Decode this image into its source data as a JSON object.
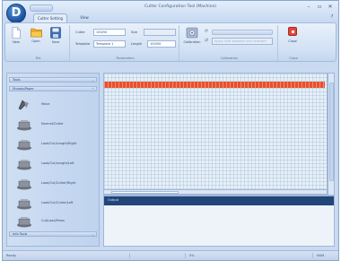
{
  "window": {
    "title": "Cutter Configuration Tool (Machine)",
    "app_button_glyph": "D",
    "controls": [
      "–",
      "▫",
      "✕"
    ],
    "ribbon_help": "?"
  },
  "tabs": [
    {
      "label": "Cutter Setting",
      "active": true
    },
    {
      "label": "View",
      "active": false
    }
  ],
  "ribbon": {
    "file_buttons": [
      {
        "label": "New",
        "icon": "new-document-icon"
      },
      {
        "label": "Open",
        "icon": "open-folder-icon"
      },
      {
        "label": "Save",
        "icon": "save-disk-icon"
      }
    ],
    "file_group_label": "File",
    "params": {
      "cutter_label": "Cutter",
      "cutter_value": "100/50",
      "size_label": "Size",
      "size_value": "",
      "template_label": "Template",
      "template_value": "Template 1",
      "length_label": "Length",
      "length_value": "100/50"
    },
    "params_group_label": "Parameters",
    "calibration": {
      "button_label": "Calibration",
      "row1_text": "",
      "row2_text": "Apply shift between the selected"
    },
    "calibration_group_label": "Calibration",
    "close_button_label": "Close",
    "close_group_label": "Close"
  },
  "left_panel": {
    "sections": [
      {
        "label": "Tools",
        "expanded": false
      },
      {
        "label": "Shapes/Paper",
        "expanded": true
      },
      {
        "label": "Info Tools",
        "expanded": false
      }
    ],
    "items": [
      {
        "label": "Move"
      },
      {
        "label": "Normal/Cutter"
      },
      {
        "label": "Load/Cut/Length/Right"
      },
      {
        "label": "Load/Cut/Length/Left"
      },
      {
        "label": "Load/Cut/Cutter/Right"
      },
      {
        "label": "Load/Cut/Cutter/Left"
      },
      {
        "label": "Cut/Load/Press"
      }
    ]
  },
  "output_panel": {
    "title": "Output"
  },
  "status_bar": {
    "left_text": "Ready",
    "mid_text": "",
    "right_text": "0%",
    "corner_text": "NUM"
  },
  "colors": {
    "accent_bar": "#e8502b",
    "ribbon_bg": "#d2e1f4",
    "output_header": "#22457a",
    "close_button": "#e2473a"
  }
}
